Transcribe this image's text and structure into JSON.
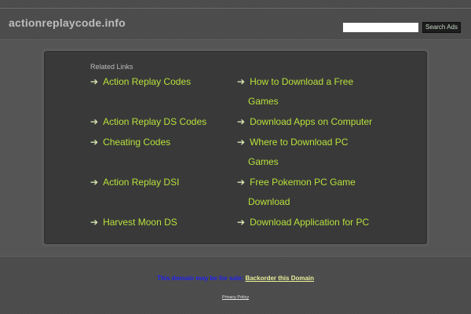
{
  "header": {
    "site_title": "actionreplaycode.info",
    "search_placeholder": "",
    "search_button": "Search Ads"
  },
  "related": {
    "heading": "Related Links",
    "arrow": "➔",
    "left": [
      {
        "label": "Action Replay Codes"
      },
      {
        "label": "Action Replay DS Codes"
      },
      {
        "label": "Cheating Codes"
      },
      {
        "label": "Action Replay DSI"
      },
      {
        "label": "Harvest Moon DS"
      }
    ],
    "right": [
      {
        "line1": "How to Download a Free",
        "line2": "Games"
      },
      {
        "line1": "Download Apps on Computer",
        "line2": ""
      },
      {
        "line1": "Where to Download PC",
        "line2": "Games"
      },
      {
        "line1": "Free Pokemon PC Game",
        "line2": "Download"
      },
      {
        "line1": "Download Application for PC",
        "line2": ""
      }
    ]
  },
  "footer": {
    "sale_text": "This domain may be for sale:",
    "backorder_link": "Backorder this Domain",
    "privacy_link": "Privacy Policy"
  },
  "colors": {
    "background": "#4b4b4b",
    "panel": "#393939",
    "link": "#b7e33b",
    "search_button_bg": "#1d1d1d"
  }
}
